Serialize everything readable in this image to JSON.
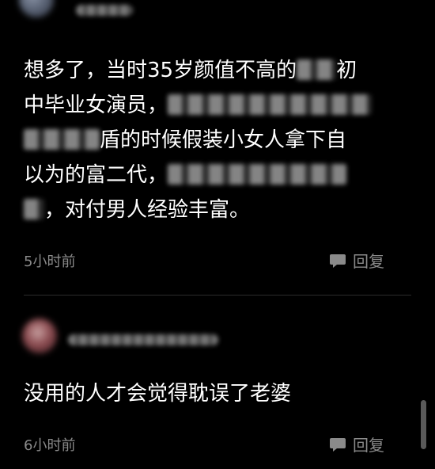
{
  "comments": [
    {
      "text_line1": "想多了，当时35岁颜值不高的",
      "text_line1_tail": "初",
      "text_line2": "中毕业女演员，",
      "text_line3_tail": "小女人拿下自",
      "text_line3_mid": "盾的时候假装",
      "text_line4": "以为的富二代，",
      "text_line5": "，对付男人经验丰富。",
      "time": "5小时前",
      "reply_label": "回复"
    },
    {
      "text": "没用的人才会觉得耽误了老婆",
      "time": "6小时前",
      "reply_label": "回复"
    }
  ],
  "colors": {
    "background": "#000000",
    "text": "#ffffff",
    "meta": "#8a8a8a",
    "divider": "#2b2b2b"
  },
  "icons": [
    "comment-bubble-icon"
  ]
}
